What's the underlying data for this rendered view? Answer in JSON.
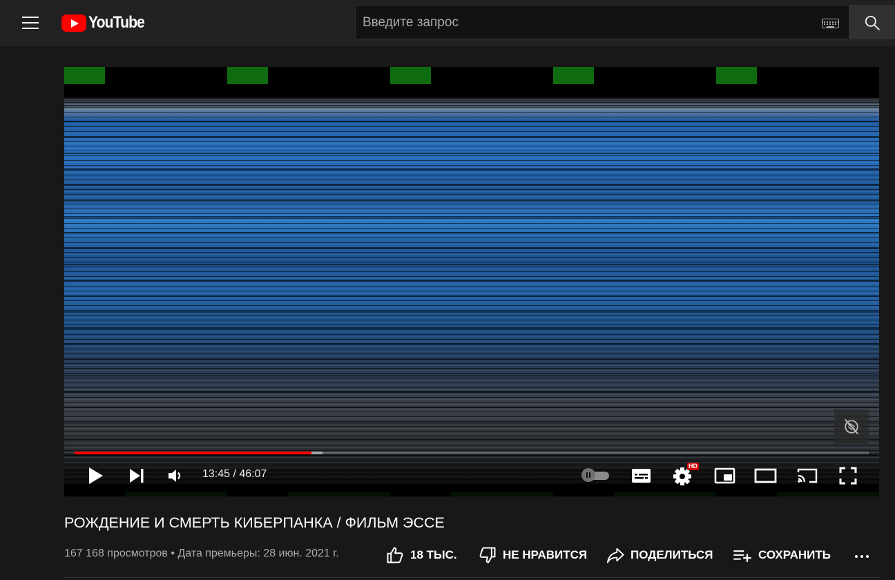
{
  "header": {
    "logo_text": "YouTube",
    "search_placeholder": "Введите запрос"
  },
  "player": {
    "current_time": "13:45",
    "duration": "46:07",
    "time_display": "13:45 / 46:07",
    "progress_played_fraction": 0.298,
    "progress_loaded_fraction": 0.312,
    "hd_badge": "HD",
    "autoplay_on": false,
    "colors": {
      "progress_played": "#ff0000",
      "video_blue": "#2a73c2",
      "green_blocks": "#0e6b10"
    }
  },
  "video": {
    "title": "РОЖДЕНИЕ И СМЕРТЬ КИБЕРПАНКА / ФИЛЬМ ЭССЕ",
    "views": "167 168 просмотров",
    "separator": "•",
    "premiere_date": "Дата премьеры: 28 июн. 2021 г.",
    "info_line": "167 168 просмотров • Дата премьеры: 28 июн. 2021 г."
  },
  "actions": {
    "like_label": "18 ТЫС.",
    "dislike_label": "НЕ НРАВИТСЯ",
    "share_label": "ПОДЕЛИТЬСЯ",
    "save_label": "СОХРАНИТЬ"
  },
  "icons": {
    "menu": "menu-icon",
    "search": "search-icon",
    "keyboard": "keyboard-icon",
    "play": "play-icon",
    "next": "next-icon",
    "volume": "volume-icon",
    "subtitles": "subtitles-icon",
    "settings": "gear-icon",
    "miniplayer": "miniplayer-icon",
    "theater": "theater-mode-icon",
    "cast": "cast-icon",
    "fullscreen": "fullscreen-icon",
    "like": "thumbs-up-icon",
    "dislike": "thumbs-down-icon",
    "share": "share-icon",
    "save": "playlist-add-icon",
    "more": "more-icon"
  }
}
